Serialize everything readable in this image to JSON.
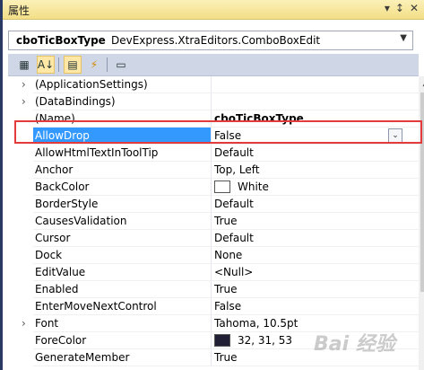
{
  "panel": {
    "title": "属性",
    "pin_glyph": "▾",
    "autohide_glyph": "↕",
    "close_glyph": "✕"
  },
  "object_selector": {
    "name": "cboTicBoxType",
    "type": "DevExpress.XtraEditors.ComboBoxEdit",
    "dropdown_glyph": "▼"
  },
  "toolbar": [
    {
      "name": "categorized-icon",
      "glyph": "▦"
    },
    {
      "name": "alphabetical-icon",
      "glyph": "A↓"
    },
    {
      "name": "properties-icon",
      "glyph": "▤"
    },
    {
      "name": "events-icon",
      "glyph": "⚡"
    },
    {
      "name": "property-pages-icon",
      "glyph": "▭"
    }
  ],
  "rows": [
    {
      "name": "(ApplicationSettings)",
      "value": "",
      "expand": "›"
    },
    {
      "name": "(DataBindings)",
      "value": "",
      "expand": "›"
    },
    {
      "name": "(Name)",
      "value": "cboTicBoxType",
      "expand": ""
    },
    {
      "name": "AllowDrop",
      "value": "False",
      "expand": ""
    },
    {
      "name": "AllowHtmlTextInToolTip",
      "value": "Default",
      "expand": ""
    },
    {
      "name": "Anchor",
      "value": "Top, Left",
      "expand": ""
    },
    {
      "name": "BackColor",
      "value": "White",
      "expand": "",
      "swatch": "#ffffff"
    },
    {
      "name": "BorderStyle",
      "value": "Default",
      "expand": ""
    },
    {
      "name": "CausesValidation",
      "value": "True",
      "expand": ""
    },
    {
      "name": "Cursor",
      "value": "Default",
      "expand": ""
    },
    {
      "name": "Dock",
      "value": "None",
      "expand": ""
    },
    {
      "name": "EditValue",
      "value": "<Null>",
      "expand": ""
    },
    {
      "name": "Enabled",
      "value": "True",
      "expand": ""
    },
    {
      "name": "EnterMoveNextControl",
      "value": "False",
      "expand": ""
    },
    {
      "name": "Font",
      "value": "Tahoma, 10.5pt",
      "expand": "›"
    },
    {
      "name": "ForeColor",
      "value": "32, 31, 53",
      "expand": "",
      "swatch": "#201f35"
    },
    {
      "name": "GenerateMember",
      "value": "True",
      "expand": ""
    }
  ],
  "selected_dropdown_glyph": "⌄",
  "scroll_up_glyph": "▲",
  "watermark": "Bai 经验"
}
